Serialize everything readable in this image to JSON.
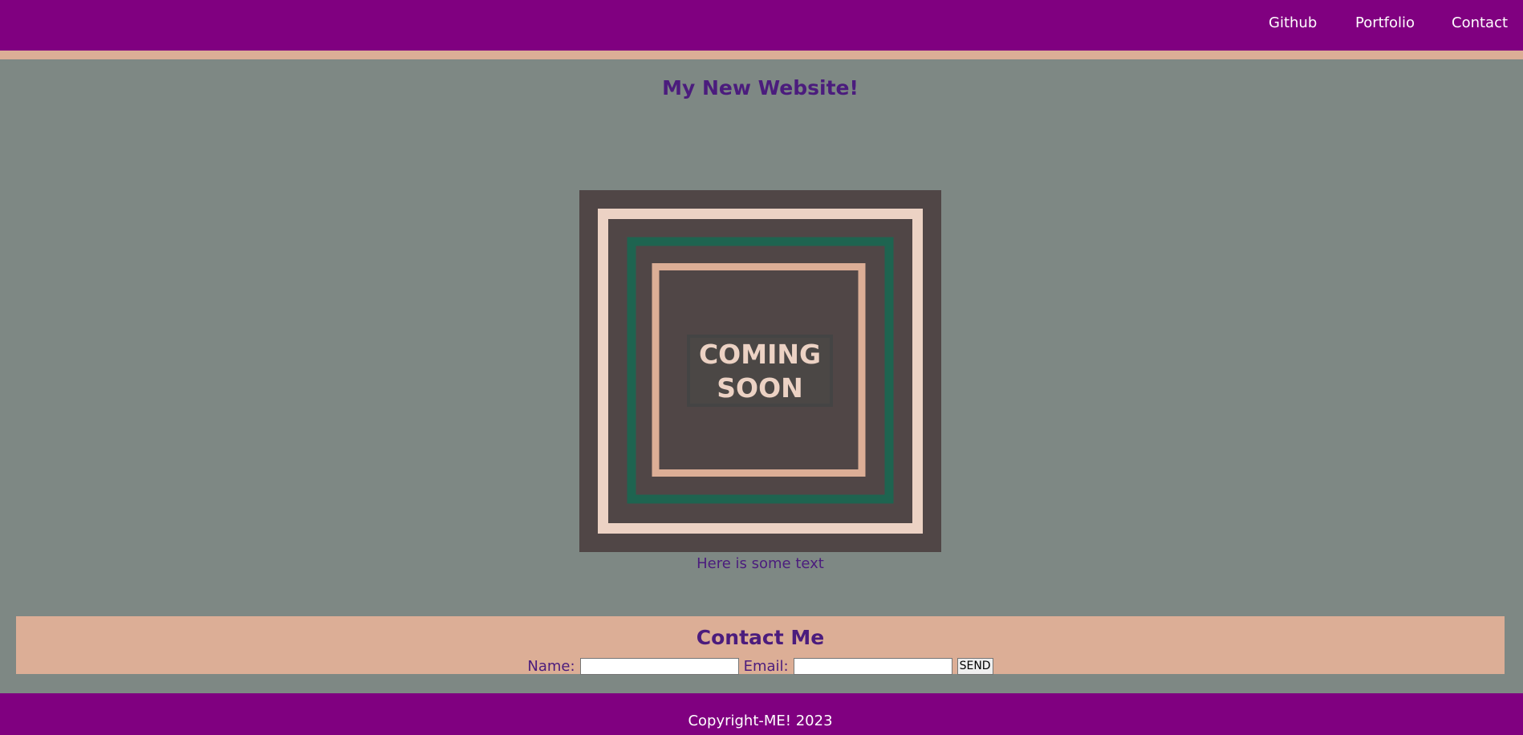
{
  "nav": {
    "links": [
      "Github",
      "Portfolio",
      "Contact"
    ]
  },
  "main": {
    "title": "My New Website!",
    "image": {
      "text_line1": "COMING",
      "text_line2": "SOON"
    },
    "caption": "Here is some text"
  },
  "contact": {
    "title": "Contact Me",
    "name_label": "Name:",
    "name_value": "",
    "email_label": "Email:",
    "email_value": "",
    "send_label": "SEND"
  },
  "footer": {
    "copyright": "Copyright-ME! 2023"
  },
  "colors": {
    "nav_bg": "#800080",
    "accent_stripe": "#dcae96",
    "page_bg": "#7e8884",
    "heading_text": "#4b1c7d",
    "image_bg": "#504646",
    "image_green": "#1e6450"
  }
}
